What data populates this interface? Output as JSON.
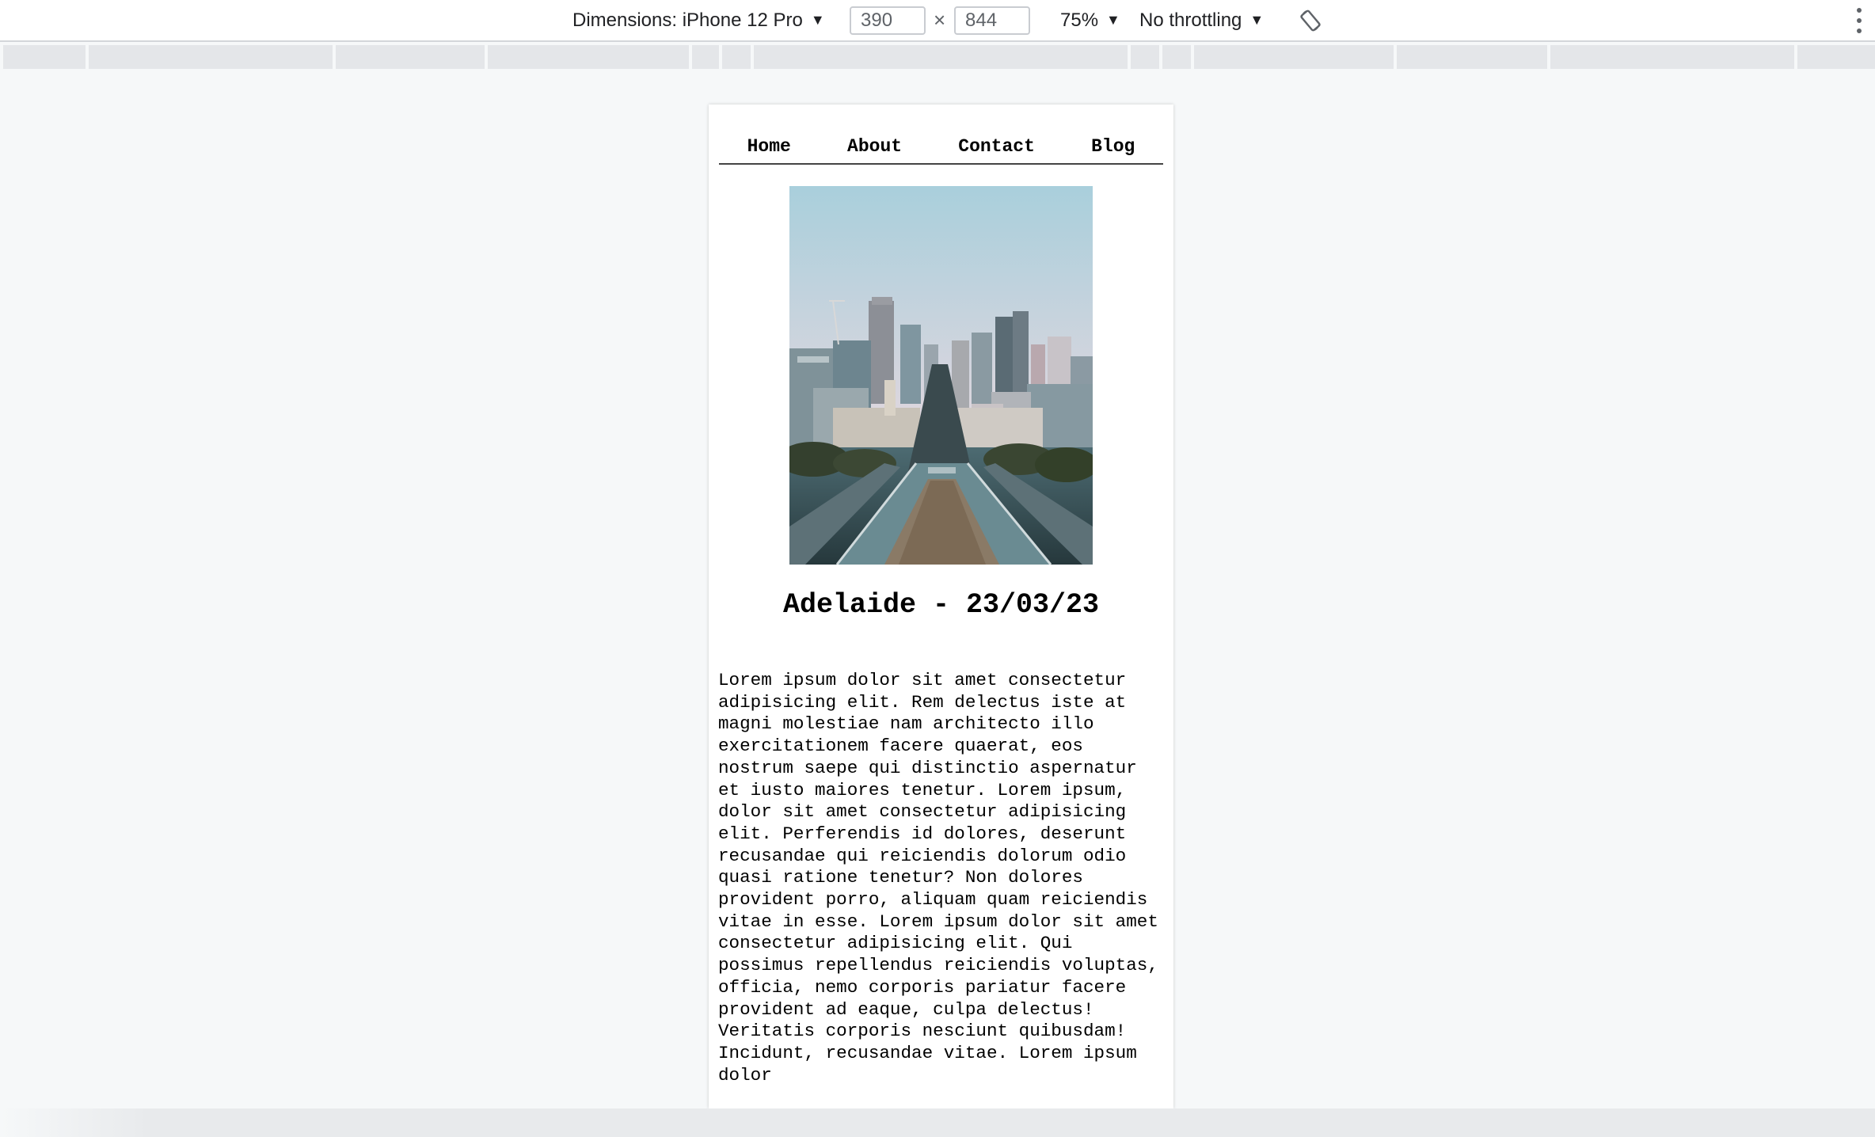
{
  "devtools": {
    "dimensions_label": "Dimensions: iPhone 12 Pro",
    "width_value": "390",
    "times_symbol": "×",
    "height_value": "844",
    "zoom_label": "75%",
    "throttling_label": "No throttling",
    "caret": "▼"
  },
  "nav": {
    "items": [
      "Home",
      "About",
      "Contact",
      "Blog"
    ]
  },
  "post": {
    "title": "Adelaide - 23/03/23",
    "body": "Lorem ipsum dolor sit amet consectetur adipisicing elit. Rem delectus iste at magni molestiae nam architecto illo exercitationem facere quaerat, eos nostrum saepe qui distinctio aspernatur et iusto maiores tenetur. Lorem ipsum, dolor sit amet consectetur adipisicing elit. Perferendis id dolores, deserunt recusandae qui reiciendis dolorum odio quasi ratione tenetur? Non dolores provident porro, aliquam quam reiciendis vitae in esse. Lorem ipsum dolor sit amet consectetur adipisicing elit. Qui possimus repellendus reiciendis voluptas, officia, nemo corporis pariatur facere provident ad eaque, culpa delectus! Veritatis corporis nesciunt quibusdam! Incidunt, recusandae vitae. Lorem ipsum dolor"
  },
  "colors": {
    "page_bg": "#f6f8f9",
    "viewport_bg": "#ffffff",
    "text": "#000000"
  }
}
